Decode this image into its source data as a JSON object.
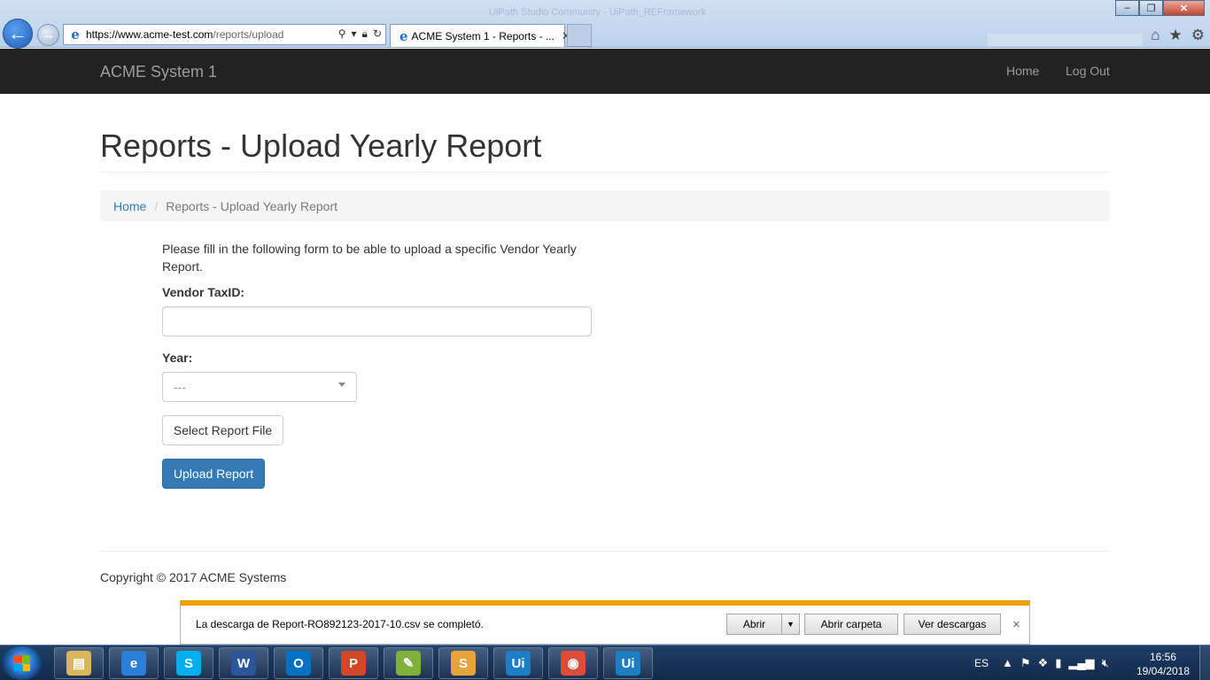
{
  "browser": {
    "url_prefix": "https://www.",
    "url_domain": "acme-test.com",
    "url_path": "/reports/upload",
    "tab_title": "ACME System 1 - Reports - ...",
    "tab_close": "✕",
    "window_title_blurred": "UiPath Studio Community - UiPath_REFramework"
  },
  "navbar": {
    "brand": "ACME System 1",
    "links": [
      "Home",
      "Log Out"
    ]
  },
  "page": {
    "title": "Reports - Upload Yearly Report",
    "breadcrumb": {
      "home": "Home",
      "separator": "/",
      "current": "Reports - Upload Yearly Report"
    },
    "intro": "Please fill in the following form to be able to upload a specific Vendor Yearly Report.",
    "vendor_label": "Vendor TaxID:",
    "vendor_value": "",
    "year_label": "Year:",
    "year_selected": "---",
    "select_file_button": "Select Report File",
    "upload_button": "Upload Report",
    "copyright": "Copyright © 2017 ACME Systems"
  },
  "download_bar": {
    "message": "La descarga de Report-RO892123-2017-10.csv se completó.",
    "open": "Abrir",
    "open_folder": "Abrir carpeta",
    "view_downloads": "Ver descargas",
    "close": "×"
  },
  "taskbar": {
    "apps": [
      {
        "name": "explorer",
        "glyph": "▤",
        "color": "#d9b65a"
      },
      {
        "name": "internet-explorer",
        "glyph": "e",
        "color": "#2b7fd8"
      },
      {
        "name": "skype",
        "glyph": "S",
        "color": "#00aff0"
      },
      {
        "name": "word",
        "glyph": "W",
        "color": "#2b579a"
      },
      {
        "name": "outlook",
        "glyph": "O",
        "color": "#0072c6"
      },
      {
        "name": "powerpoint",
        "glyph": "P",
        "color": "#d24726"
      },
      {
        "name": "notepad-plus",
        "glyph": "✎",
        "color": "#7fb23a"
      },
      {
        "name": "slack",
        "glyph": "S",
        "color": "#e8a33d"
      },
      {
        "name": "uipath-studio",
        "glyph": "Ui",
        "color": "#1d7ec3"
      },
      {
        "name": "chrome",
        "glyph": "◉",
        "color": "#dd4b39"
      },
      {
        "name": "uipath-robot",
        "glyph": "Ui",
        "color": "#1d7ec3"
      }
    ],
    "language": "ES",
    "time": "16:56",
    "date": "19/04/2018"
  },
  "colors": {
    "navbar_bg": "#222222",
    "primary": "#337ab7",
    "download_accent": "#f0a000"
  }
}
